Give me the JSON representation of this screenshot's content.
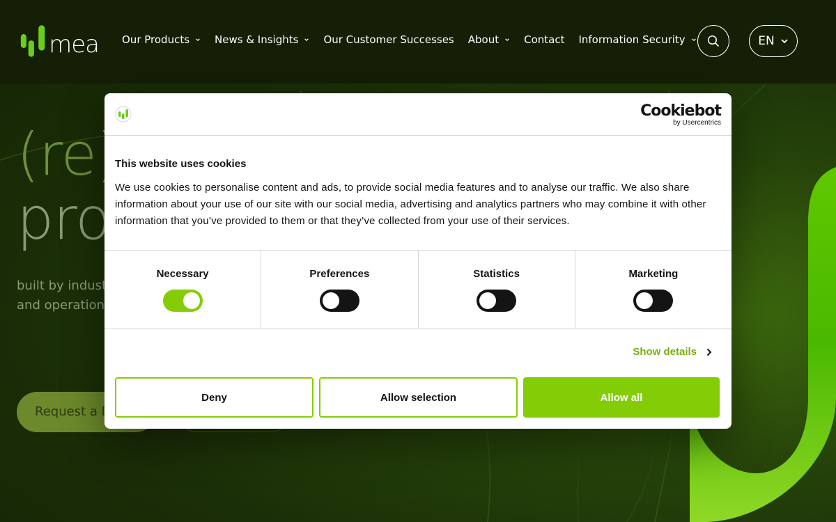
{
  "site": {
    "logo_text": "mea",
    "nav": [
      {
        "label": "Our Products",
        "has_dropdown": true
      },
      {
        "label": "News & Insights",
        "has_dropdown": true
      },
      {
        "label": "Our Customer Successes",
        "has_dropdown": false
      },
      {
        "label": "About",
        "has_dropdown": true
      },
      {
        "label": "Contact",
        "has_dropdown": false
      },
      {
        "label": "Information Security",
        "has_dropdown": true
      }
    ],
    "search_icon": "search-icon",
    "language": "EN"
  },
  "hero": {
    "title_line1": "(re)",
    "title_line2": "pro",
    "subtitle_line1": "built by indust",
    "subtitle_line2": "and operation",
    "primary_button": "Request a D"
  },
  "cookie_dialog": {
    "provider_logo": "Cookiebot",
    "provider_sub": "by Usercentrics",
    "title": "This website uses cookies",
    "text": "We use cookies to personalise content and ads, to provide social media features and to analyse our traffic. We also share information about your use of our site with our social media, advertising and analytics partners who may combine it with other information that you’ve provided to them or that they’ve collected from your use of their services.",
    "categories": [
      {
        "label": "Necessary",
        "enabled": true
      },
      {
        "label": "Preferences",
        "enabled": false
      },
      {
        "label": "Statistics",
        "enabled": false
      },
      {
        "label": "Marketing",
        "enabled": false
      }
    ],
    "show_details": "Show details",
    "buttons": {
      "deny": "Deny",
      "allow_selection": "Allow selection",
      "allow_all": "Allow all"
    }
  },
  "colors": {
    "accent_green": "#84cd06",
    "nav_bg": "#141f06",
    "details_link": "#79ae0f"
  }
}
